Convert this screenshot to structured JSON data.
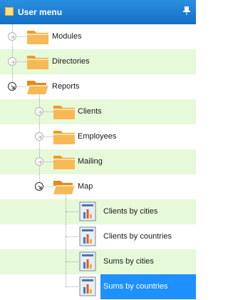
{
  "header": {
    "title": "User menu",
    "pin_icon": "pin-icon",
    "menu_icon": "menu-icon"
  },
  "tree": {
    "items": [
      {
        "label": "Modules",
        "level": 0,
        "type": "folder",
        "expanded": false
      },
      {
        "label": "Directories",
        "level": 0,
        "type": "folder",
        "expanded": false
      },
      {
        "label": "Reports",
        "level": 0,
        "type": "folder",
        "expanded": true
      },
      {
        "label": "Clients",
        "level": 1,
        "type": "folder",
        "expanded": false
      },
      {
        "label": "Employees",
        "level": 1,
        "type": "folder",
        "expanded": false
      },
      {
        "label": "Mailing",
        "level": 1,
        "type": "folder",
        "expanded": false
      },
      {
        "label": "Map",
        "level": 1,
        "type": "folder",
        "expanded": true
      },
      {
        "label": "Clients by cities",
        "level": 2,
        "type": "report"
      },
      {
        "label": "Clients by countries",
        "level": 2,
        "type": "report"
      },
      {
        "label": "Sums by cities",
        "level": 2,
        "type": "report"
      },
      {
        "label": "Sums by countries",
        "level": 2,
        "type": "report",
        "selected": true
      }
    ]
  },
  "colors": {
    "header": "#1e7fd6",
    "alt_row": "#e6f9d9",
    "selection": "#1e90ff",
    "folder": "#f5a623"
  }
}
